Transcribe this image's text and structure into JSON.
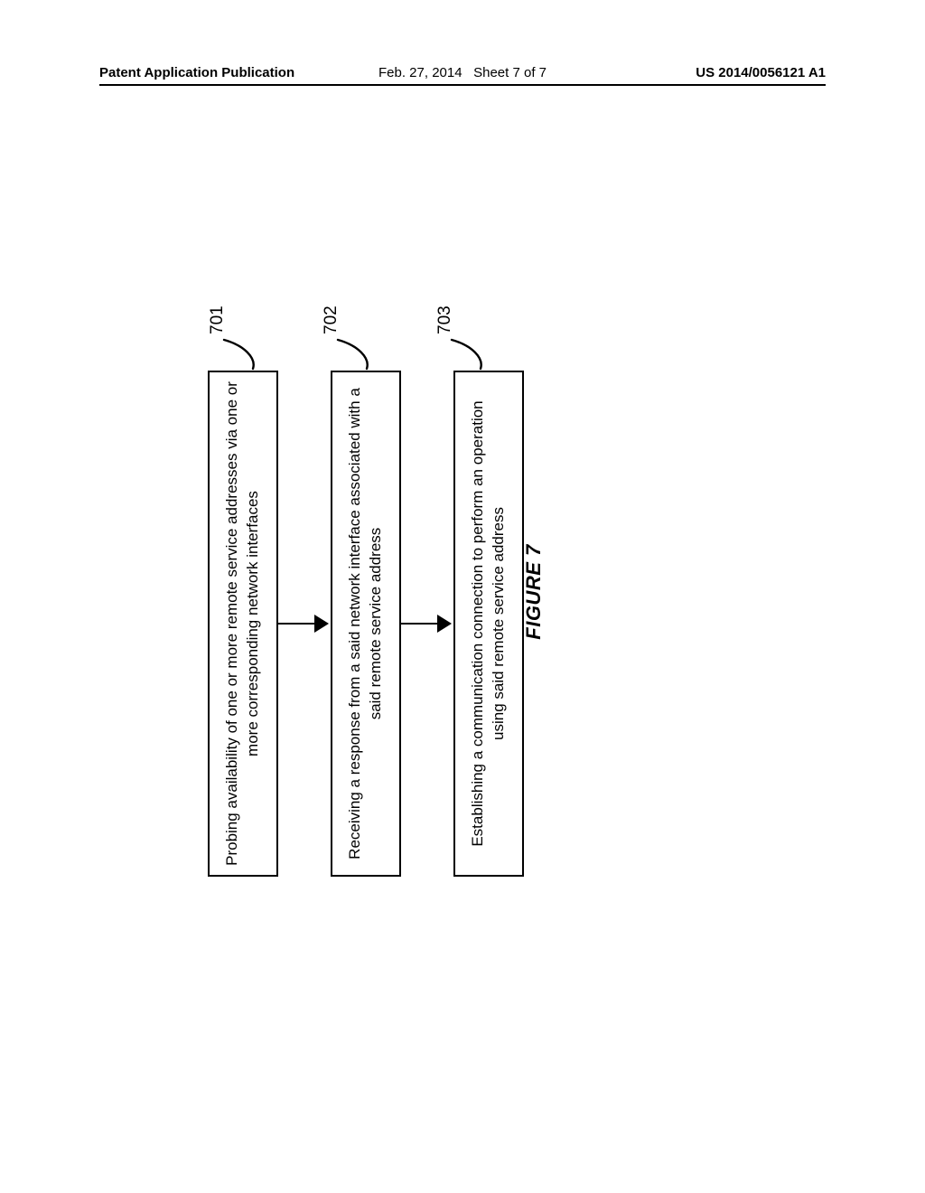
{
  "header": {
    "left": "Patent Application Publication",
    "mid_date": "Feb. 27, 2014",
    "mid_sheet": "Sheet 7 of 7",
    "right": "US 2014/0056121 A1"
  },
  "flow": {
    "steps": [
      {
        "ref": "701",
        "text": "Probing availability of one or more remote service addresses via one or more corresponding network interfaces"
      },
      {
        "ref": "702",
        "text": "Receiving a response from a said network interface associated with a said remote service address"
      },
      {
        "ref": "703",
        "text": "Establishing a communication connection to perform an operation using said remote service address"
      }
    ]
  },
  "figure_label": "FIGURE 7"
}
